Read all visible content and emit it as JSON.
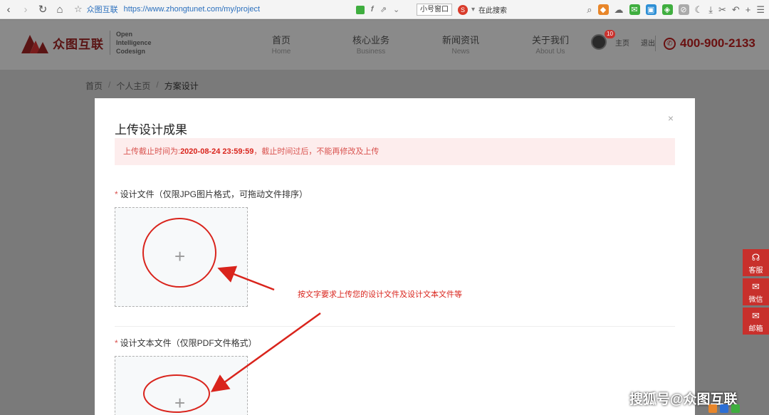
{
  "browser": {
    "site_name": "众图互联",
    "url": "https://www.zhongtunet.com/my/project",
    "small_window_label": "小号窗口",
    "search_placeholder": "在此搜索"
  },
  "header": {
    "logo_cn": "众图互联",
    "logo_en": [
      "Open",
      "Intelligence",
      "Codesign"
    ],
    "nav": [
      {
        "cn": "首页",
        "en": "Home"
      },
      {
        "cn": "核心业务",
        "en": "Business"
      },
      {
        "cn": "新闻资讯",
        "en": "News"
      },
      {
        "cn": "关于我们",
        "en": "About Us"
      }
    ],
    "badge_count": "10",
    "home_link": "主页",
    "logout_link": "退出",
    "phone": "400-900-2133"
  },
  "breadcrumb": {
    "items": [
      "首页",
      "个人主页",
      "方案设计"
    ],
    "separator": "/"
  },
  "modal": {
    "title": "上传设计成果",
    "close_symbol": "×",
    "alert_prefix": "上传截止时间为:",
    "alert_deadline": "2020-08-24 23:59:59",
    "alert_suffix": "，截止时间过后，不能再修改及上传",
    "field1_label": "设计文件（仅限JPG图片格式，可拖动文件排序）",
    "field2_label": "设计文本文件（仅限PDF文件格式）",
    "required_mark": "*",
    "plus_symbol": "+"
  },
  "annotation": {
    "text": "按文字要求上传您的设计文件及设计文本文件等",
    "color": "#d9241c"
  },
  "float_bar": [
    {
      "label": "客服",
      "icon": "headset-icon"
    },
    {
      "label": "微信",
      "icon": "wechat-icon"
    },
    {
      "label": "邮箱",
      "icon": "mail-icon"
    }
  ],
  "watermark": "搜狐号@众图互联",
  "colors": {
    "brand_red": "#c8302c",
    "alert_bg": "#fdeded"
  }
}
